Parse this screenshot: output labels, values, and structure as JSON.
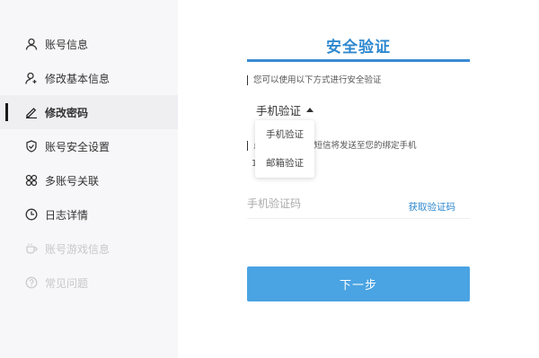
{
  "sidebar": {
    "items": [
      {
        "label": "账号信息",
        "icon": "user-icon"
      },
      {
        "label": "修改基本信息",
        "icon": "user-edit-icon"
      },
      {
        "label": "修改密码",
        "icon": "pencil-icon"
      },
      {
        "label": "账号安全设置",
        "icon": "shield-check-icon"
      },
      {
        "label": "多账号关联",
        "icon": "multi-account-icon"
      },
      {
        "label": "日志详情",
        "icon": "clock-icon"
      },
      {
        "label": "账号游戏信息",
        "icon": "cup-icon"
      },
      {
        "label": "常见问题",
        "icon": "question-icon"
      }
    ]
  },
  "main": {
    "title": "安全验证",
    "hint": "您可以使用以下方式进行安全验证",
    "method_label": "手机验证",
    "dropdown": [
      "手机验证",
      "邮箱验证"
    ],
    "sms_hint_prefix": "点",
    "sms_hint": "短信将发送至您的绑定手机",
    "phone_prefix": "1",
    "code_placeholder": "手机验证码",
    "get_code": "获取验证码",
    "next": "下一步"
  },
  "colors": {
    "accent": "#2e88cf",
    "button": "#4aa3e2"
  }
}
